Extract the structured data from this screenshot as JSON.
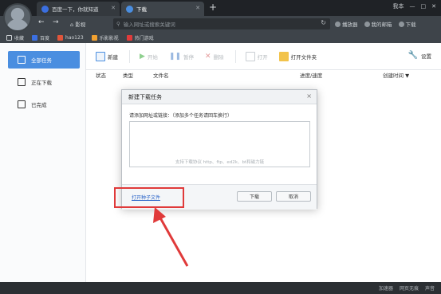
{
  "browser": {
    "tabs": [
      {
        "label": "百度一下，你就知道",
        "active": false
      },
      {
        "label": "下载",
        "active": true
      }
    ],
    "new_tab": "+",
    "window_user": "我本",
    "nav": {
      "back": "←",
      "forward": "→",
      "home_label": "影视",
      "address_placeholder": "输入网址或搜索关键词",
      "right_items": [
        "播放器",
        "我的邮箱",
        "下载"
      ]
    },
    "bookmarks": [
      {
        "label": "收藏",
        "color": "#cfd3d6"
      },
      {
        "label": "百度",
        "color": "#3b6fe0"
      },
      {
        "label": "hao123",
        "color": "#e0553b"
      },
      {
        "label": "乐影影视",
        "color": "#f0a030"
      },
      {
        "label": "热门游戏",
        "color": "#e03b3b"
      }
    ]
  },
  "download_manager": {
    "sidebar": [
      {
        "label": "全部任务",
        "active": true
      },
      {
        "label": "正在下载",
        "active": false
      },
      {
        "label": "已完成",
        "active": false
      }
    ],
    "toolbar": {
      "new": "新建",
      "start": "开始",
      "pause": "暂停",
      "delete": "删除",
      "open": "打开",
      "open_folder": "打开文件夹",
      "settings": "设置"
    },
    "columns": {
      "status": "状态",
      "type": "类型",
      "filename": "文件名",
      "progress": "进度/速度",
      "created": "创建时间 ▼"
    },
    "dialog": {
      "title": "新建下载任务",
      "close": "×",
      "hint": "请添加网址或链接：（添加多个任务请回车换行）",
      "placeholder": "支持下载协议 http、ftp、ed2k、bt和磁力链",
      "torrent_link": "打开种子文件",
      "download_button": "下载",
      "cancel_button": "取消"
    }
  },
  "statusbar": [
    "加速器",
    "网页无痕",
    "声音"
  ],
  "colors": {
    "accent": "#4a8ee0",
    "annotation": "#e03a3a",
    "chrome_dark": "#2b2f33"
  }
}
